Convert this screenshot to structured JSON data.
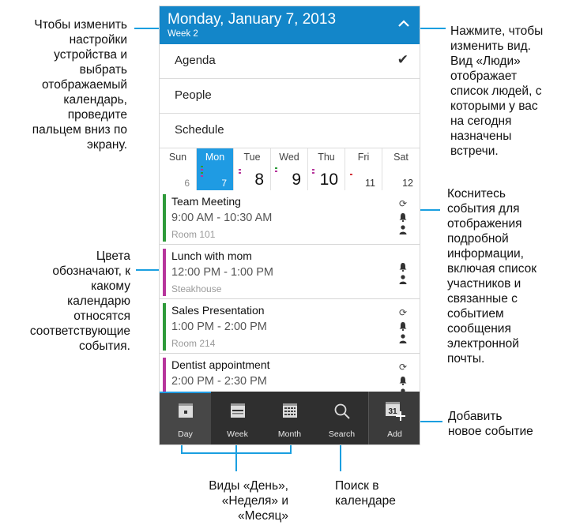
{
  "header": {
    "date": "Monday, January 7, 2013",
    "week": "Week 2"
  },
  "menu": [
    {
      "label": "Agenda",
      "checked": true
    },
    {
      "label": "People",
      "checked": false
    },
    {
      "label": "Schedule",
      "checked": false
    }
  ],
  "days": [
    {
      "name": "Sun",
      "num": "6"
    },
    {
      "name": "Mon",
      "num": "7"
    },
    {
      "name": "Tue",
      "num": "8"
    },
    {
      "name": "Wed",
      "num": "9"
    },
    {
      "name": "Thu",
      "num": "10"
    },
    {
      "name": "Fri",
      "num": "11"
    },
    {
      "name": "Sat",
      "num": "12"
    }
  ],
  "events": [
    {
      "title": "Team Meeting",
      "time": "9:00 AM - 10:30 AM",
      "location": "Room 101",
      "color": "#2e9a3a"
    },
    {
      "title": "Lunch with mom",
      "time": "12:00 PM - 1:00 PM",
      "location": "Steakhouse",
      "color": "#b7359c"
    },
    {
      "title": "Sales Presentation",
      "time": "1:00 PM - 2:00 PM",
      "location": "Room 214",
      "color": "#2e9a3a"
    },
    {
      "title": "Dentist appointment",
      "time": "2:00 PM - 2:30 PM",
      "location": "",
      "color": "#b7359c"
    }
  ],
  "actions": {
    "day": "Day",
    "week": "Week",
    "month": "Month",
    "search": "Search",
    "add": "Add",
    "add_icon_number": "31"
  },
  "colors": {
    "header": "#1386c9",
    "accent": "#1f9be3",
    "callout_line": "#1a9fe0"
  },
  "callouts": {
    "settings": "Чтобы изменить\nнастройки\nустройства и\nвыбрать\nотображаемый\nкалендарь,\nпроведите\nпальцем вниз по\nэкрану.",
    "view": "Нажмите, чтобы\nизменить вид.\nВид «Люди»\nотображает\nсписок людей, с\nкоторыми у вас\nна сегодня\nназначены\nвстречи.",
    "event": "Коснитесь\nсобытия для\nотображения\nподробной\nинформации,\nвключая список\nучастников и\nсвязанные с\nсобытием\nсообщения\nэлектронной\nпочты.",
    "colors": "Цвета\nобозначают, к\nкакому\nкалендарю\nотносятся\nсоответствующие\nсобытия.",
    "add": "Добавить\nновое событие",
    "views": "Виды «День»,\n«Неделя» и\n«Месяц»",
    "search": "Поиск в\nкалендаре"
  }
}
